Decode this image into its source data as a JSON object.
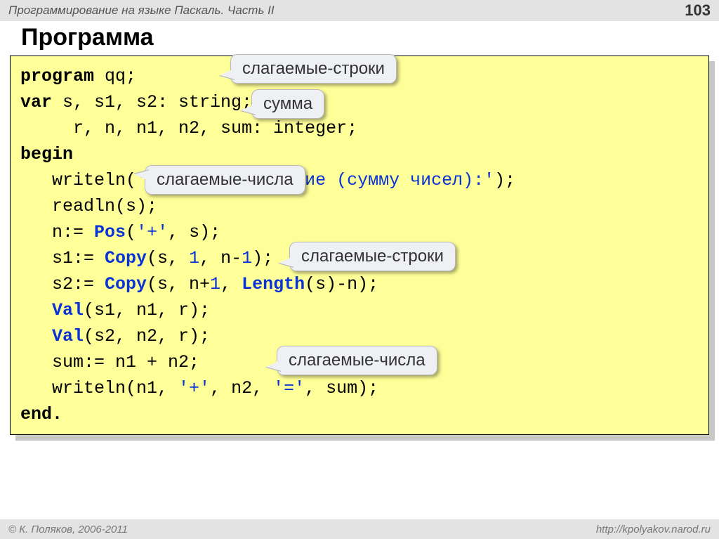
{
  "header": {
    "title": "Программирование на языке Паскаль. Часть II",
    "page": "103"
  },
  "slide_title": "Программа",
  "callouts": {
    "c1": "слагаемые-строки",
    "c2": "сумма",
    "c3": "слагаемые-числа",
    "c4": "слагаемые-строки",
    "c5": "слагаемые-числа"
  },
  "code": {
    "l1": {
      "program": "program",
      "name": " qq;"
    },
    "l2": {
      "var": "var",
      "decl": " s, s1, s2: string;"
    },
    "l3": "     r, n, n1, n2, sum: integer;",
    "l4": "begin",
    "l5": {
      "p1": "   writeln(",
      "s": "'Введите выражение (сумму чисел):'",
      "p2": ");"
    },
    "l6": "   readln(s);",
    "l7": {
      "p1": "   n:= ",
      "fn": "Pos",
      "p2": "(",
      "s": "'+'",
      "p3": ", s);"
    },
    "l8": {
      "p1": "   s1:= ",
      "fn": "Copy",
      "p2": "(s, ",
      "n1": "1",
      "p3": ", n-",
      "n2": "1",
      "p4": ");"
    },
    "l9": {
      "p1": "   s2:= ",
      "fn": "Copy",
      "p2": "(s, n+",
      "n1": "1",
      "p3": ", ",
      "fn2": "Length",
      "p4": "(s)-n);"
    },
    "l10": {
      "p1": "   ",
      "fn": "Val",
      "p2": "(s1, n1, r);"
    },
    "l11": {
      "p1": "   ",
      "fn": "Val",
      "p2": "(s2, n2, r);"
    },
    "l12": "   sum:= n1 + n2;",
    "l13": {
      "p1": "   writeln(n1, ",
      "s1": "'+'",
      "p2": ", n2, ",
      "s2": "'='",
      "p3": ", sum);"
    },
    "l14": "end."
  },
  "footer": {
    "copyright": "© К. Поляков, 2006-2011",
    "url": "http://kpolyakov.narod.ru"
  }
}
